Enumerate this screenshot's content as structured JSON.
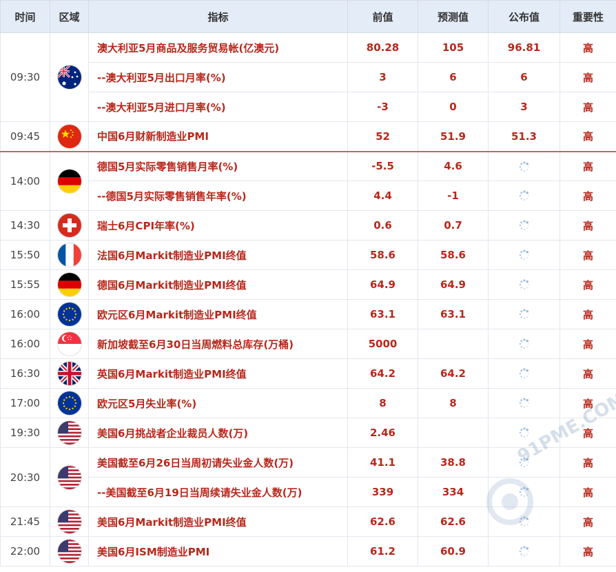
{
  "headers": {
    "time": "时间",
    "region": "区域",
    "indicator": "指标",
    "previous": "前值",
    "forecast": "预测值",
    "actual": "公布值",
    "importance": "重要性"
  },
  "rows": [
    {
      "time": "09:30",
      "flag": "australia-flag-icon",
      "indicator": "澳大利亚5月商品及服务贸易帐(亿澳元)",
      "previous": "80.28",
      "forecast": "105",
      "actual": "96.81",
      "importance": "高"
    },
    {
      "time": "",
      "flag": "",
      "indicator": "--澳大利亚5月出口月率(%)",
      "previous": "3",
      "forecast": "6",
      "actual": "6",
      "importance": "高"
    },
    {
      "time": "",
      "flag": "",
      "indicator": "--澳大利亚5月进口月率(%)",
      "previous": "-3",
      "forecast": "0",
      "actual": "3",
      "importance": "高"
    },
    {
      "time": "09:45",
      "flag": "china-flag-icon",
      "indicator": "中国6月财新制造业PMI",
      "previous": "52",
      "forecast": "51.9",
      "actual": "51.3",
      "importance": "高"
    },
    {
      "time": "14:00",
      "flag": "germany-flag-icon",
      "indicator": "德国5月实际零售销售月率(%)",
      "previous": "-5.5",
      "forecast": "4.6",
      "actual": "",
      "importance": "高"
    },
    {
      "time": "",
      "flag": "",
      "indicator": "--德国5月实际零售销售年率(%)",
      "previous": "4.4",
      "forecast": "-1",
      "actual": "",
      "importance": "高"
    },
    {
      "time": "14:30",
      "flag": "switzerland-flag-icon",
      "indicator": "瑞士6月CPI年率(%)",
      "previous": "0.6",
      "forecast": "0.7",
      "actual": "",
      "importance": "高"
    },
    {
      "time": "15:50",
      "flag": "france-flag-icon",
      "indicator": "法国6月Markit制造业PMI终值",
      "previous": "58.6",
      "forecast": "58.6",
      "actual": "",
      "importance": "高"
    },
    {
      "time": "15:55",
      "flag": "germany-flag-icon",
      "indicator": "德国6月Markit制造业PMI终值",
      "previous": "64.9",
      "forecast": "64.9",
      "actual": "",
      "importance": "高"
    },
    {
      "time": "16:00",
      "flag": "eurozone-flag-icon",
      "indicator": "欧元区6月Markit制造业PMI终值",
      "previous": "63.1",
      "forecast": "63.1",
      "actual": "",
      "importance": "高"
    },
    {
      "time": "16:00",
      "flag": "singapore-flag-icon",
      "indicator": "新加坡截至6月30日当周燃料总库存(万桶)",
      "previous": "5000",
      "forecast": "",
      "actual": "",
      "importance": "高"
    },
    {
      "time": "16:30",
      "flag": "uk-flag-icon",
      "indicator": "英国6月Markit制造业PMI终值",
      "previous": "64.2",
      "forecast": "64.2",
      "actual": "",
      "importance": "高"
    },
    {
      "time": "17:00",
      "flag": "eurozone-flag-icon",
      "indicator": "欧元区5月失业率(%)",
      "previous": "8",
      "forecast": "8",
      "actual": "",
      "importance": "高"
    },
    {
      "time": "19:30",
      "flag": "usa-flag-icon",
      "indicator": "美国6月挑战者企业裁员人数(万)",
      "previous": "2.46",
      "forecast": "",
      "actual": "",
      "importance": "高"
    },
    {
      "time": "20:30",
      "flag": "usa-flag-icon",
      "indicator": "美国截至6月26日当周初请失业金人数(万)",
      "previous": "41.1",
      "forecast": "38.8",
      "actual": "",
      "importance": "高"
    },
    {
      "time": "",
      "flag": "",
      "indicator": "--美国截至6月19日当周续请失业金人数(万)",
      "previous": "339",
      "forecast": "334",
      "actual": "",
      "importance": "高"
    },
    {
      "time": "21:45",
      "flag": "usa-flag-icon",
      "indicator": "美国6月Markit制造业PMI终值",
      "previous": "62.6",
      "forecast": "62.6",
      "actual": "",
      "importance": "高"
    },
    {
      "time": "22:00",
      "flag": "usa-flag-icon",
      "indicator": "美国6月ISM制造业PMI",
      "previous": "61.2",
      "forecast": "60.9",
      "actual": "",
      "importance": "高"
    }
  ],
  "pending_icon": "loading-spinner-icon",
  "watermark": "91PME.COM",
  "colors": {
    "header_bg": "#e4ecf7",
    "value_red": "#b8271b",
    "separator": "#b96b6b"
  }
}
